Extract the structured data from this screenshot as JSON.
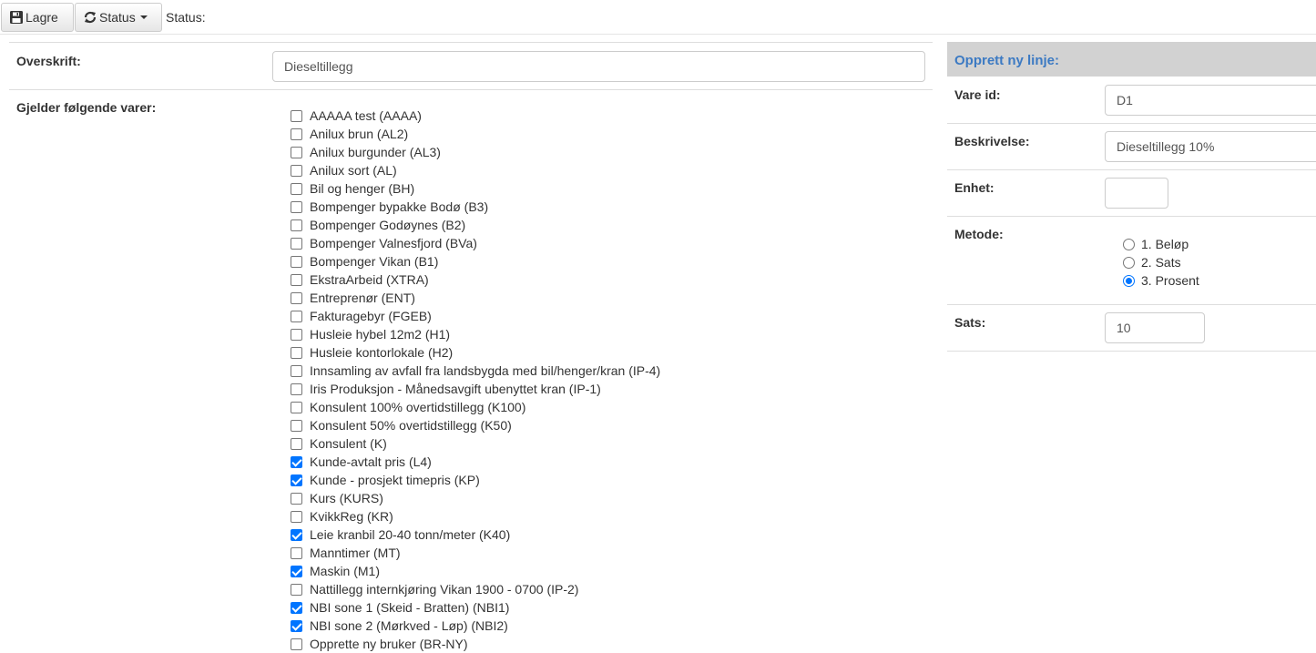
{
  "toolbar": {
    "save_label": "Lagre",
    "status_button_label": "Status",
    "status_text": "Status:"
  },
  "form": {
    "heading_label": "Overskrift:",
    "heading_value": "Dieseltillegg",
    "applies_label": "Gjelder følgende varer:",
    "items": [
      {
        "label": "AAAAA test (AAAA)",
        "checked": false
      },
      {
        "label": "Anilux brun (AL2)",
        "checked": false
      },
      {
        "label": "Anilux burgunder (AL3)",
        "checked": false
      },
      {
        "label": "Anilux sort (AL)",
        "checked": false
      },
      {
        "label": "Bil og henger (BH)",
        "checked": false
      },
      {
        "label": "Bompenger bypakke Bodø (B3)",
        "checked": false
      },
      {
        "label": "Bompenger Godøynes (B2)",
        "checked": false
      },
      {
        "label": "Bompenger Valnesfjord (BVa)",
        "checked": false
      },
      {
        "label": "Bompenger Vikan (B1)",
        "checked": false
      },
      {
        "label": "EkstraArbeid (XTRA)",
        "checked": false
      },
      {
        "label": "Entreprenør (ENT)",
        "checked": false
      },
      {
        "label": "Fakturagebyr (FGEB)",
        "checked": false
      },
      {
        "label": "Husleie hybel 12m2 (H1)",
        "checked": false
      },
      {
        "label": "Husleie kontorlokale (H2)",
        "checked": false
      },
      {
        "label": "Innsamling av avfall fra landsbygda med bil/henger/kran (IP-4)",
        "checked": false
      },
      {
        "label": "Iris Produksjon - Månedsavgift ubenyttet kran (IP-1)",
        "checked": false
      },
      {
        "label": "Konsulent 100% overtidstillegg (K100)",
        "checked": false
      },
      {
        "label": "Konsulent 50% overtidstillegg (K50)",
        "checked": false
      },
      {
        "label": "Konsulent (K)",
        "checked": false
      },
      {
        "label": "Kunde-avtalt pris (L4)",
        "checked": true
      },
      {
        "label": "Kunde - prosjekt timepris (KP)",
        "checked": true
      },
      {
        "label": "Kurs (KURS)",
        "checked": false
      },
      {
        "label": "KvikkReg (KR)",
        "checked": false
      },
      {
        "label": "Leie kranbil 20-40 tonn/meter (K40)",
        "checked": true
      },
      {
        "label": "Manntimer (MT)",
        "checked": false
      },
      {
        "label": "Maskin (M1)",
        "checked": true
      },
      {
        "label": "Nattillegg internkjøring Vikan 1900 - 0700 (IP-2)",
        "checked": false
      },
      {
        "label": "NBI sone 1 (Skeid - Bratten) (NBI1)",
        "checked": true
      },
      {
        "label": "NBI sone 2 (Mørkved - Løp) (NBI2)",
        "checked": true
      },
      {
        "label": "Opprette ny bruker (BR-NY)",
        "checked": false
      }
    ]
  },
  "panel": {
    "title": "Opprett ny linje:",
    "vare_id_label": "Vare id:",
    "vare_id_value": "D1",
    "beskrivelse_label": "Beskrivelse:",
    "beskrivelse_value": "Dieseltillegg 10%",
    "enhet_label": "Enhet:",
    "enhet_value": "",
    "metode_label": "Metode:",
    "metode_options": [
      {
        "label": "1. Beløp",
        "checked": false
      },
      {
        "label": "2. Sats",
        "checked": false
      },
      {
        "label": "3. Prosent",
        "checked": true
      }
    ],
    "sats_label": "Sats:",
    "sats_value": "10"
  },
  "colors": {
    "accent": "#0075ff",
    "panel_title": "#3c7ac3",
    "panel_header_bg": "#d2d2d2"
  }
}
